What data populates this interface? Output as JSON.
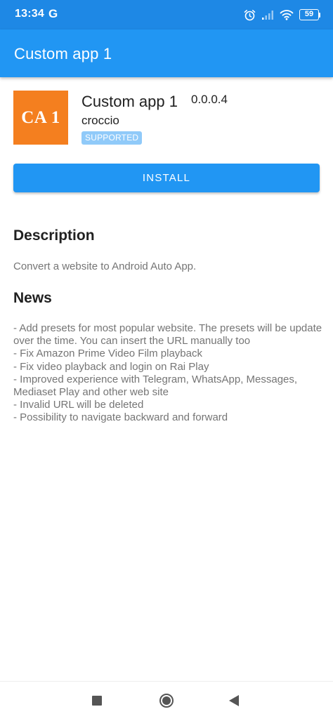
{
  "status_bar": {
    "time": "13:34",
    "g_icon": "G",
    "battery": "59",
    "icons": [
      "alarm-icon",
      "signal-icon",
      "wifi-icon",
      "battery-icon"
    ]
  },
  "app_bar": {
    "title": "Custom app 1"
  },
  "app": {
    "icon_text": "CA 1",
    "icon_color": "#F47F1F",
    "name": "Custom app 1",
    "version": "0.0.0.4",
    "developer": "croccio",
    "badge": "SUPPORTED"
  },
  "install_label": "INSTALL",
  "description": {
    "heading": "Description",
    "text": "Convert a website to Android Auto App."
  },
  "news": {
    "heading": "News",
    "lines": [
      "- Add presets for most popular website. The presets will be update over the time. You can insert the URL manually too",
      "- Fix Amazon Prime Video Film playback",
      "- Fix video playback and login on Rai Play",
      "- Improved experience with Telegram, WhatsApp, Messages, Mediaset Play and other web site",
      "- Invalid URL will be deleted",
      "- Possibility to navigate backward and forward"
    ]
  },
  "colors": {
    "status_bar": "#1E88E5",
    "primary": "#2196F3",
    "badge": "#90CAF9"
  },
  "nav_bar": {
    "icons": [
      "recents-square-icon",
      "home-circle-icon",
      "back-triangle-icon"
    ]
  }
}
